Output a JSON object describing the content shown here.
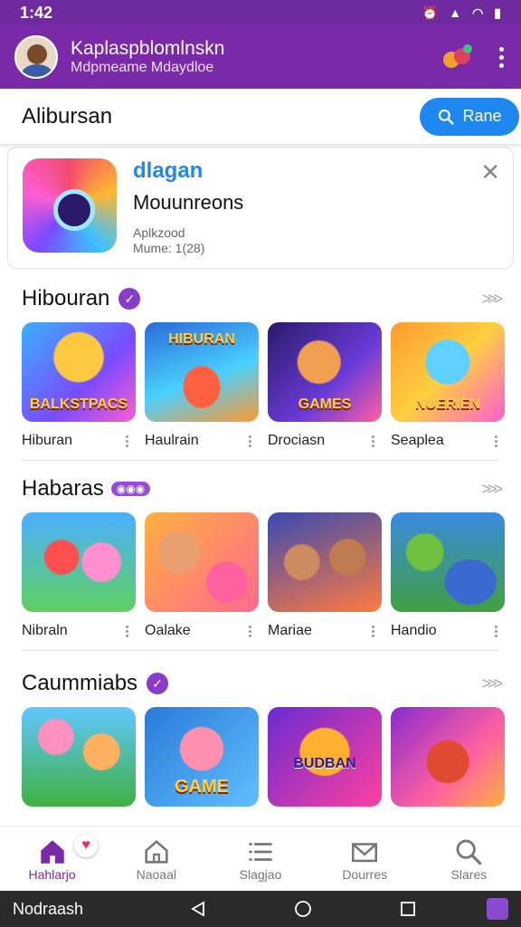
{
  "status_bar": {
    "time": "1:42"
  },
  "app_bar": {
    "title": "Kaplaspblomlnskn",
    "subtitle": "Mdpmeame Mdaydloe"
  },
  "search_bar": {
    "title": "Alibursan",
    "search_label": "Rane"
  },
  "featured": {
    "brand": "dlagan",
    "name": "Mouunreons",
    "meta_1": "Aplkzood",
    "meta_2": "Mume: 1(28)"
  },
  "sections": [
    {
      "title": "Hibouran",
      "badge": "✓",
      "tiles": [
        {
          "label": "Hiburan",
          "art_text": "BALKSTPACS"
        },
        {
          "label": "Haulrain",
          "art_text": "HIBURAN"
        },
        {
          "label": "Drociasn",
          "art_text": "GAMES"
        },
        {
          "label": "Seaplea",
          "art_text": "NUERIEN"
        }
      ]
    },
    {
      "title": "Habaras",
      "badge": "◉◉◉",
      "tiles": [
        {
          "label": "Nibraln",
          "art_text": ""
        },
        {
          "label": "Oalake",
          "art_text": ""
        },
        {
          "label": "Mariae",
          "art_text": ""
        },
        {
          "label": "Handio",
          "art_text": ""
        }
      ]
    },
    {
      "title": "Caummiabs",
      "badge": "✓",
      "tiles": [
        {
          "label": "",
          "art_text": ""
        },
        {
          "label": "",
          "art_text": "GAME"
        },
        {
          "label": "",
          "art_text": "BUDBAN"
        },
        {
          "label": "",
          "art_text": ""
        }
      ]
    }
  ],
  "bottom_nav": [
    {
      "label": "Hahlarjo",
      "icon": "home-icon"
    },
    {
      "label": "Naoaal",
      "icon": "house-outline-icon"
    },
    {
      "label": "Slagjao",
      "icon": "list-icon"
    },
    {
      "label": "Dourres",
      "icon": "mail-icon"
    },
    {
      "label": "Slares",
      "icon": "search-icon"
    }
  ],
  "system_nav": {
    "label": "Nodraash"
  },
  "colors": {
    "primary": "#7a2aa8",
    "accent": "#1e88f0"
  }
}
